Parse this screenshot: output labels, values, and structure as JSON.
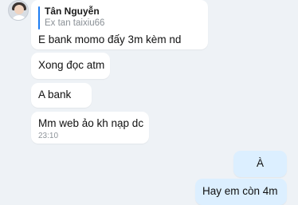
{
  "messages": [
    {
      "direction": "incoming",
      "quote": {
        "name": "Tân Nguyễn",
        "text": "Ex tan taixiu66"
      },
      "text": "E bank momo đấy 3m kèm nd"
    },
    {
      "direction": "incoming",
      "text": "Xong đọc atm"
    },
    {
      "direction": "incoming",
      "text": "A bank"
    },
    {
      "direction": "incoming",
      "text": "Mm web ảo kh nạp dc",
      "time": "23:10"
    },
    {
      "direction": "outgoing",
      "text": "À"
    },
    {
      "direction": "outgoing",
      "text": "Hay em còn 4m"
    }
  ],
  "colors": {
    "background": "#eef2f6",
    "incoming_bubble": "#ffffff",
    "outgoing_bubble": "#dcefff",
    "quote_bar": "#1d7df2"
  },
  "icons": {
    "avatar": "user-avatar"
  }
}
